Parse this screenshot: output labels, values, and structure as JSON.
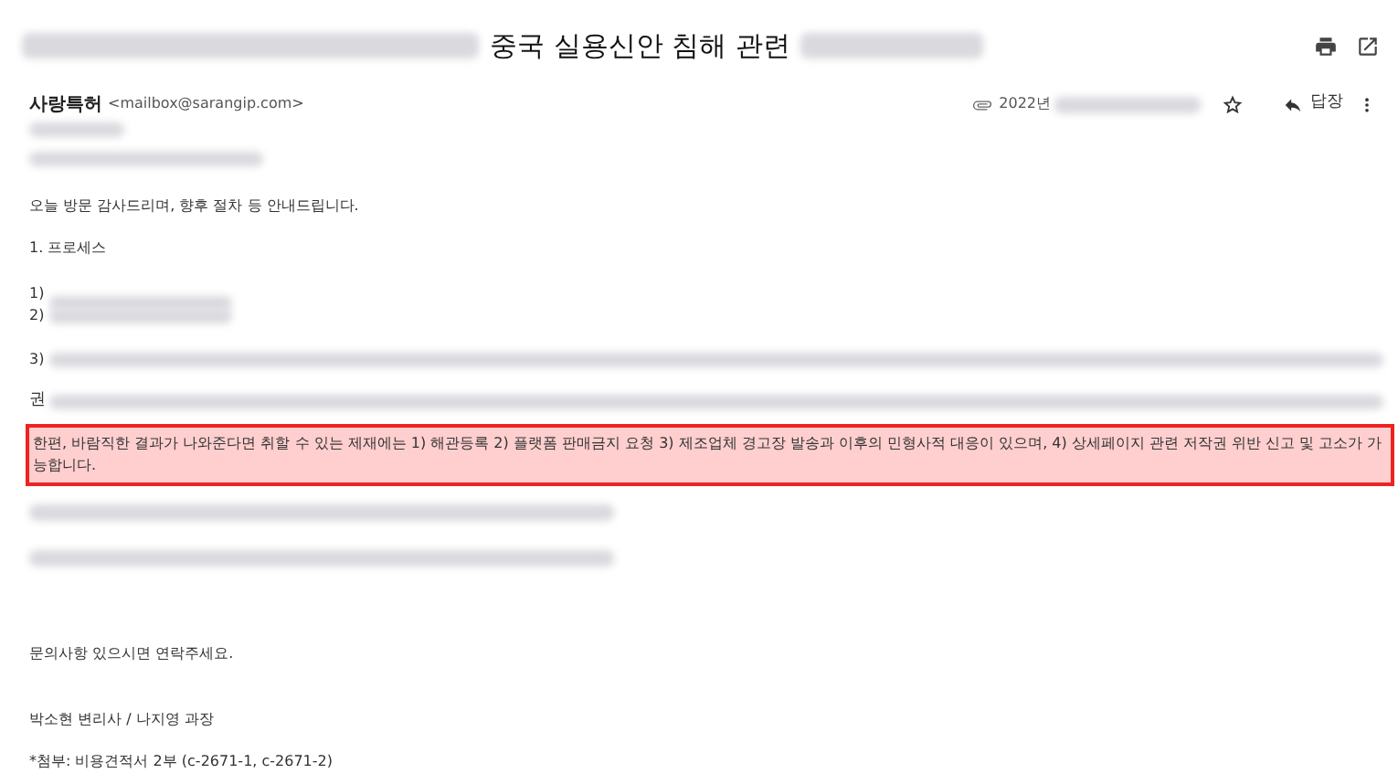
{
  "subject": {
    "visible_text": "중국 실용신안 침해 관련"
  },
  "sender": {
    "name": "사랑특허",
    "email": "<mailbox@sarangip.com>",
    "date_prefix": "2022년",
    "reply_label": "답장"
  },
  "body": [
    {
      "kind": "text",
      "text": "오늘 방문 감사드리며, 향후 절차 등 안내드립니다."
    },
    {
      "kind": "text",
      "text": "1. 프로세스"
    },
    {
      "kind": "numbered",
      "text": "1)"
    },
    {
      "kind": "numbered",
      "text": "2)"
    },
    {
      "kind": "numbered",
      "text": "3)"
    },
    {
      "kind": "numbered",
      "text": "권"
    },
    {
      "kind": "highlight",
      "text": "한편, 바람직한 결과가 나와준다면 취할 수 있는 제재에는 1) 해관등록 2) 플랫폼 판매금지 요청 3) 제조업체 경고장 발송과 이후의 민형사적 대응이 있으며, 4) 상세페이지 관련 저작권 위반 신고 및 고소가 가능합니다."
    },
    {
      "kind": "text",
      "text": "문의사항 있으시면 연락주세요."
    },
    {
      "kind": "text",
      "text": "박소현 변리사 / 나지영 과장"
    },
    {
      "kind": "text",
      "text": "*첨부: 비용견적서 2부 (c-2671-1, c-2671-2)"
    }
  ]
}
